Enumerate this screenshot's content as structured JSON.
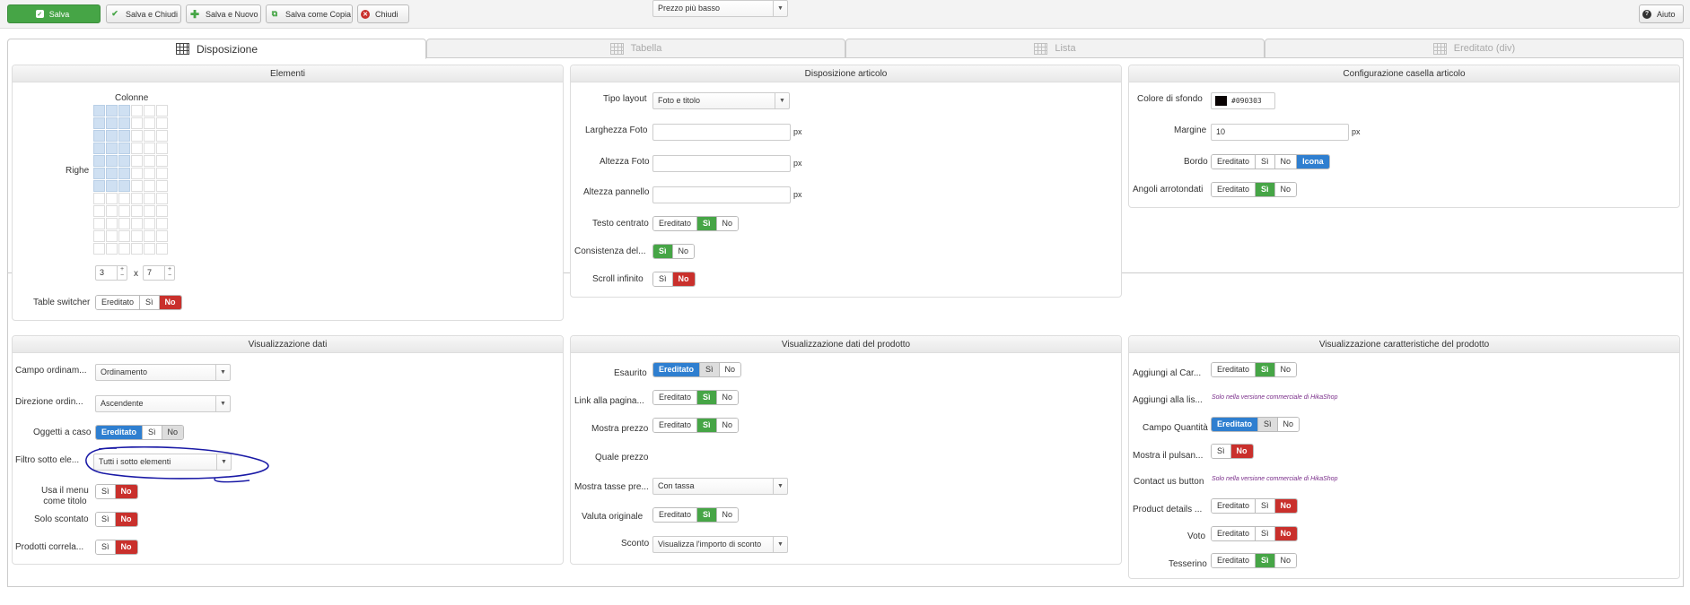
{
  "toolbar": {
    "save": "Salva",
    "save_close": "Salva e Chiudi",
    "save_new": "Salva e Nuovo",
    "save_copy": "Salva come Copia",
    "close": "Chiudi",
    "help": "Aiuto"
  },
  "tabs": [
    "Disposizione",
    "Tabella",
    "Lista",
    "Ereditato (div)"
  ],
  "elementi": {
    "title": "Elementi",
    "colonne": "Colonne",
    "righe": "Righe",
    "cols_value": "3",
    "times": "x",
    "rows_value": "7",
    "table_switcher_label": "Table switcher",
    "table_switcher": [
      "Ereditato",
      "Sì",
      "No"
    ]
  },
  "disposizione": {
    "title": "Disposizione articolo",
    "tipo_layout_label": "Tipo layout",
    "tipo_layout_value": "Foto e titolo",
    "larghezza_foto_label": "Larghezza Foto",
    "altezza_foto_label": "Altezza Foto",
    "altezza_pannello_label": "Altezza pannello",
    "px": "px",
    "testo_centrato_label": "Testo centrato",
    "testo_centrato": [
      "Ereditato",
      "Sì",
      "No"
    ],
    "consistenza_label": "Consistenza del...",
    "consistenza": [
      "Sì",
      "No"
    ],
    "scroll_label": "Scroll infinito",
    "scroll": [
      "Sì",
      "No"
    ]
  },
  "configurazione": {
    "title": "Configurazione casella articolo",
    "colore_label": "Colore di sfondo",
    "colore_value": "#090303",
    "margine_label": "Margine",
    "margine_value": "10",
    "px": "px",
    "bordo_label": "Bordo",
    "bordo": [
      "Ereditato",
      "Sì",
      "No",
      "Icona"
    ],
    "angoli_label": "Angoli arrotondati",
    "angoli": [
      "Ereditato",
      "Sì",
      "No"
    ]
  },
  "vis_dati": {
    "title": "Visualizzazione dati",
    "campo_label": "Campo ordinam...",
    "campo_value": "Ordinamento",
    "direzione_label": "Direzione ordin...",
    "direzione_value": "Ascendente",
    "oggetti_label": "Oggetti a caso",
    "oggetti": [
      "Ereditato",
      "Sì",
      "No"
    ],
    "filtro_label": "Filtro sotto ele...",
    "filtro_value": "Tutti i sotto elementi",
    "usa_menu_label1": "Usa il menu",
    "usa_menu_label2": "come titolo",
    "usa_menu": [
      "Sì",
      "No"
    ],
    "solo_scontato_label": "Solo scontato",
    "solo_scontato": [
      "Sì",
      "No"
    ],
    "prodotti_label": "Prodotti correla...",
    "prodotti": [
      "Sì",
      "No"
    ]
  },
  "vis_prodotto": {
    "title": "Visualizzazione dati del prodotto",
    "esaurito_label": "Esaurito",
    "esaurito": [
      "Ereditato",
      "Sì",
      "No"
    ],
    "link_label": "Link alla pagina...",
    "link": [
      "Ereditato",
      "Sì",
      "No"
    ],
    "mostra_prezzo_label": "Mostra prezzo",
    "mostra_prezzo": [
      "Ereditato",
      "Sì",
      "No"
    ],
    "quale_prezzo_label": "Quale prezzo",
    "quale_prezzo_value": "Prezzo più basso",
    "mostra_tasse_label": "Mostra tasse pre...",
    "mostra_tasse_value": "Con tassa",
    "valuta_label": "Valuta originale",
    "valuta": [
      "Ereditato",
      "Sì",
      "No"
    ],
    "sconto_label": "Sconto",
    "sconto_value": "Visualizza l'importo di sconto"
  },
  "vis_caratteristiche": {
    "title": "Visualizzazione caratteristiche del prodotto",
    "aggiungi_car_label": "Aggiungi al Car...",
    "aggiungi_car": [
      "Ereditato",
      "Sì",
      "No"
    ],
    "aggiungi_lis_label": "Aggiungi alla lis...",
    "commercial": "Solo nella versione commerciale di HikaShop",
    "campo_quantita_label": "Campo Quantità",
    "campo_quantita": [
      "Ereditato",
      "Sì",
      "No"
    ],
    "mostra_pulsan_label": "Mostra il pulsan...",
    "mostra_pulsan": [
      "Sì",
      "No"
    ],
    "contact_label": "Contact us button",
    "product_details_label": "Product details ...",
    "product_details": [
      "Ereditato",
      "Sì",
      "No"
    ],
    "voto_label": "Voto",
    "voto": [
      "Ereditato",
      "Sì",
      "No"
    ],
    "tesserino_label": "Tesserino",
    "tesserino": [
      "Ereditato",
      "Sì",
      "No"
    ]
  },
  "colors": {
    "green": "#46a546",
    "red": "#c9302c",
    "blue": "#2f7fd0",
    "annotation": "#1a1aa6"
  }
}
